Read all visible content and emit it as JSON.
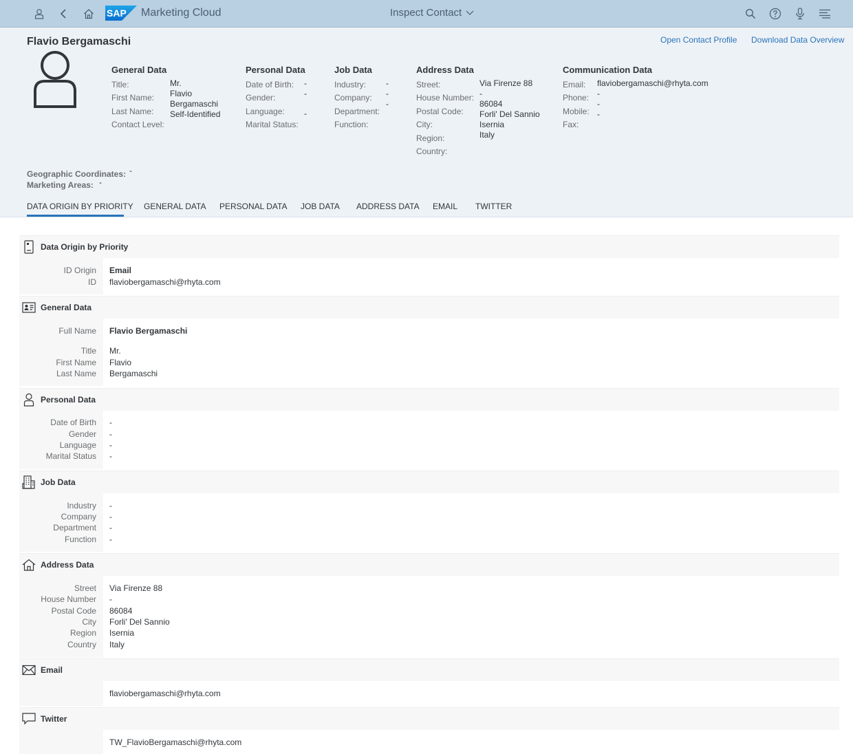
{
  "shell": {
    "app_title": "Marketing Cloud",
    "center_title": "Inspect Contact",
    "icons": [
      "user-icon",
      "back-icon",
      "home-icon",
      "search-icon",
      "help-icon",
      "microphone-icon",
      "notifications-icon"
    ]
  },
  "header": {
    "name": "Flavio Bergamaschi",
    "links": {
      "open_profile": "Open Contact Profile",
      "download": "Download Data Overview"
    },
    "general": {
      "title": "General Data",
      "labels": [
        "Title:",
        "First Name:",
        "Last Name:",
        "Contact Level:"
      ],
      "values": [
        "Mr.",
        "Flavio",
        "Bergamaschi",
        "Self-Identified"
      ]
    },
    "personal": {
      "title": "Personal Data",
      "labels": [
        "Date of Birth:",
        "Gender:",
        "Language:",
        "Marital Status:"
      ],
      "values": [
        "-",
        "-",
        "-"
      ]
    },
    "job": {
      "title": "Job Data",
      "labels": [
        "Industry:",
        "Company:",
        "Department:",
        "Function:"
      ],
      "values": [
        "-",
        "-",
        "-"
      ]
    },
    "address": {
      "title": "Address Data",
      "labels": [
        "Street:",
        "House Number:",
        "Postal Code:",
        "City:",
        "Region:",
        "Country:"
      ],
      "values": [
        "Via Firenze 88",
        "-",
        "86084",
        "Forli' Del Sannio",
        "Isernia",
        "Italy"
      ]
    },
    "communication": {
      "title": "Communication Data",
      "labels": [
        "Email:",
        "Phone:",
        "Mobile:",
        "Fax:"
      ],
      "values": [
        "flaviobergamaschi@rhyta.com",
        "-",
        "-",
        "-"
      ]
    },
    "geo": {
      "coords_label": "Geographic Coordinates:",
      "coords_value": "-",
      "areas_label": "Marketing Areas:",
      "areas_value": "-"
    }
  },
  "tabs": [
    "DATA ORIGIN BY PRIORITY",
    "GENERAL DATA",
    "PERSONAL DATA",
    "JOB DATA",
    "ADDRESS DATA",
    "EMAIL",
    "TWITTER"
  ],
  "sections": {
    "origin": {
      "title": "Data Origin by Priority",
      "labels": [
        "ID Origin",
        "ID"
      ],
      "values": [
        "Email",
        "flaviobergamaschi@rhyta.com"
      ]
    },
    "general": {
      "title": "General Data",
      "full_name_label": "Full Name",
      "full_name": "Flavio Bergamaschi",
      "labels": [
        "Title",
        "First Name",
        "Last Name"
      ],
      "values": [
        "Mr.",
        "Flavio",
        "Bergamaschi"
      ]
    },
    "personal": {
      "title": "Personal Data",
      "labels": [
        "Date of Birth",
        "Gender",
        "Language",
        "Marital Status"
      ],
      "values": [
        "-",
        "-",
        "-",
        "-"
      ]
    },
    "job": {
      "title": "Job Data",
      "labels": [
        "Industry",
        "Company",
        "Department",
        "Function"
      ],
      "values": [
        "-",
        "-",
        "-",
        "-"
      ]
    },
    "address": {
      "title": "Address Data",
      "labels": [
        "Street",
        "House Number",
        "Postal Code",
        "City",
        "Region",
        "Country"
      ],
      "values": [
        "Via Firenze 88",
        "-",
        "86084",
        "Forli' Del Sannio",
        "Isernia",
        "Italy"
      ]
    },
    "email": {
      "title": "Email",
      "value": "flaviobergamaschi@rhyta.com"
    },
    "twitter": {
      "title": "Twitter",
      "value": "TW_FlavioBergamaschi@rhyta.com"
    }
  }
}
